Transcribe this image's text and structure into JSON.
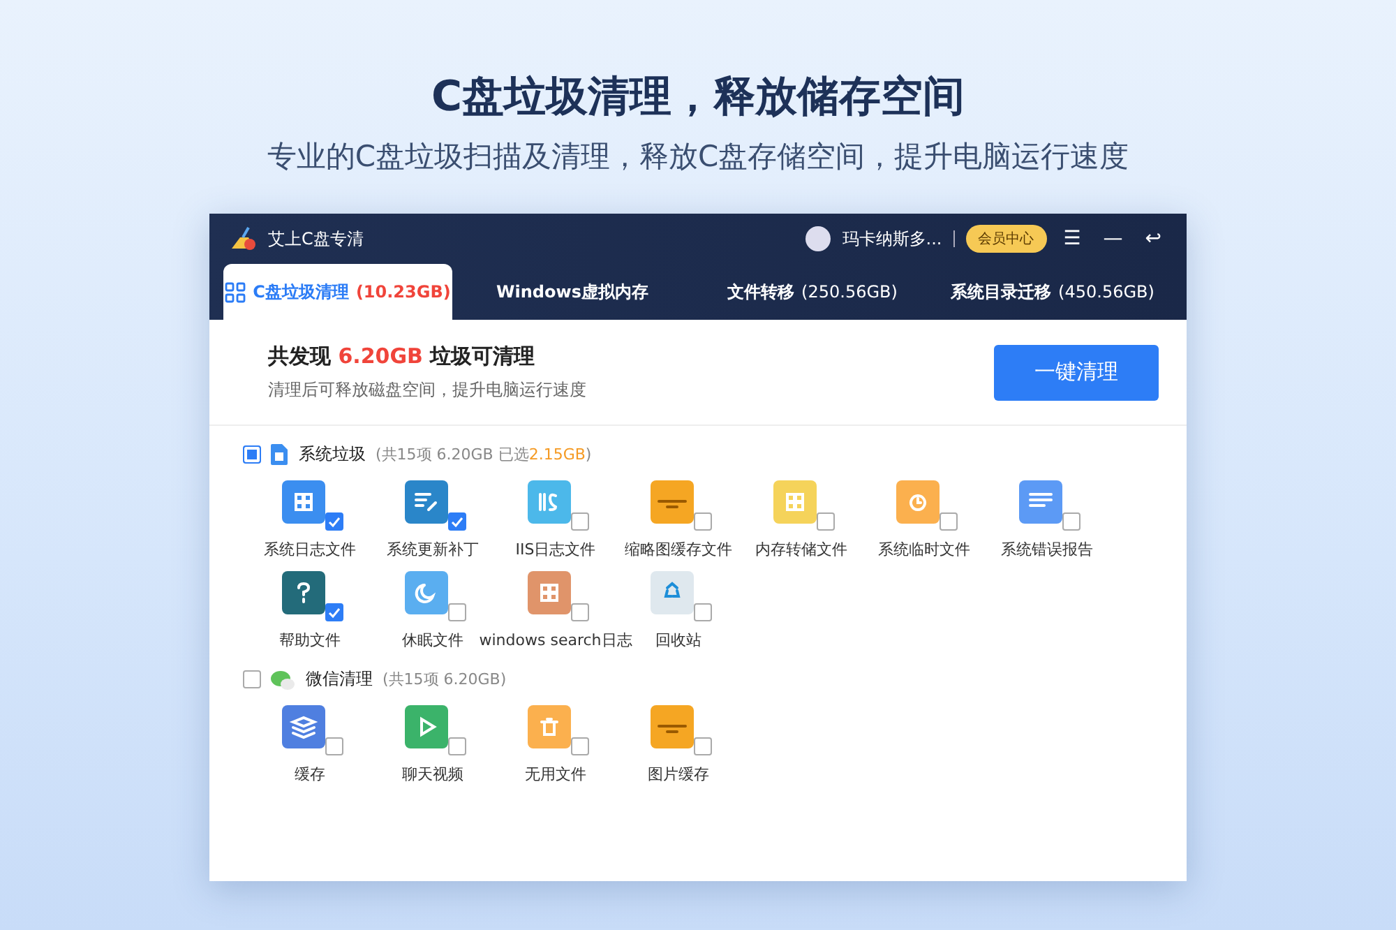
{
  "hero": {
    "title": "C盘垃圾清理，释放储存空间",
    "subtitle": "专业的C盘垃圾扫描及清理，释放C盘存储空间，提升电脑运行速度"
  },
  "window": {
    "title": "艾上C盘专清",
    "user": "玛卡纳斯多...",
    "vip": "会员中心",
    "menu_icon": "☰",
    "minimize_icon": "—",
    "back_icon": "↩"
  },
  "tabs": [
    {
      "label": "C盘垃圾清理",
      "size": "(10.23GB)",
      "selected": true
    },
    {
      "label": "Windows虚拟内存",
      "selected": false
    },
    {
      "label": "文件转移",
      "size": "(250.56GB)",
      "selected": false
    },
    {
      "label": "系统目录迁移",
      "size": "(450.56GB)",
      "selected": false
    }
  ],
  "summary": {
    "prefix": "共发现",
    "amount": "6.20GB",
    "suffix": "垃圾可清理",
    "note": "清理后可释放磁盘空间，提升电脑运行速度",
    "button": "一键清理"
  },
  "sections": [
    {
      "kind": "system",
      "name": "系统垃圾",
      "checked": false,
      "partial": true,
      "info": "(共15项 6.20GB 已选",
      "selected_size": "2.15GB",
      "close": ")",
      "items": [
        {
          "label": "系统日志文件",
          "kind": "doc",
          "checked": true
        },
        {
          "label": "系统更新补丁",
          "kind": "patch",
          "checked": true
        },
        {
          "label": "IIS日志文件",
          "kind": "iis",
          "checked": false
        },
        {
          "label": "缩略图缓存文件",
          "kind": "picture",
          "checked": false
        },
        {
          "label": "内存转储文件",
          "kind": "dump",
          "checked": false
        },
        {
          "label": "系统临时文件",
          "kind": "temp",
          "checked": false
        },
        {
          "label": "系统错误报告",
          "kind": "report",
          "checked": false
        },
        {
          "label": "帮助文件",
          "kind": "help",
          "checked": true
        },
        {
          "label": "休眠文件",
          "kind": "sleep",
          "checked": false
        },
        {
          "label": "windows search日志",
          "kind": "search",
          "checked": false
        },
        {
          "label": "回收站",
          "kind": "bin",
          "checked": false
        }
      ]
    },
    {
      "kind": "wechat",
      "name": "微信清理",
      "checked": false,
      "partial": false,
      "info": "(共15项 6.20GB)",
      "items": [
        {
          "label": "缓存",
          "kind": "layers",
          "checked": false
        },
        {
          "label": "聊天视频",
          "kind": "video",
          "checked": false
        },
        {
          "label": "无用文件",
          "kind": "trash",
          "checked": false
        },
        {
          "label": "图片缓存",
          "kind": "picture",
          "checked": false
        }
      ]
    }
  ]
}
